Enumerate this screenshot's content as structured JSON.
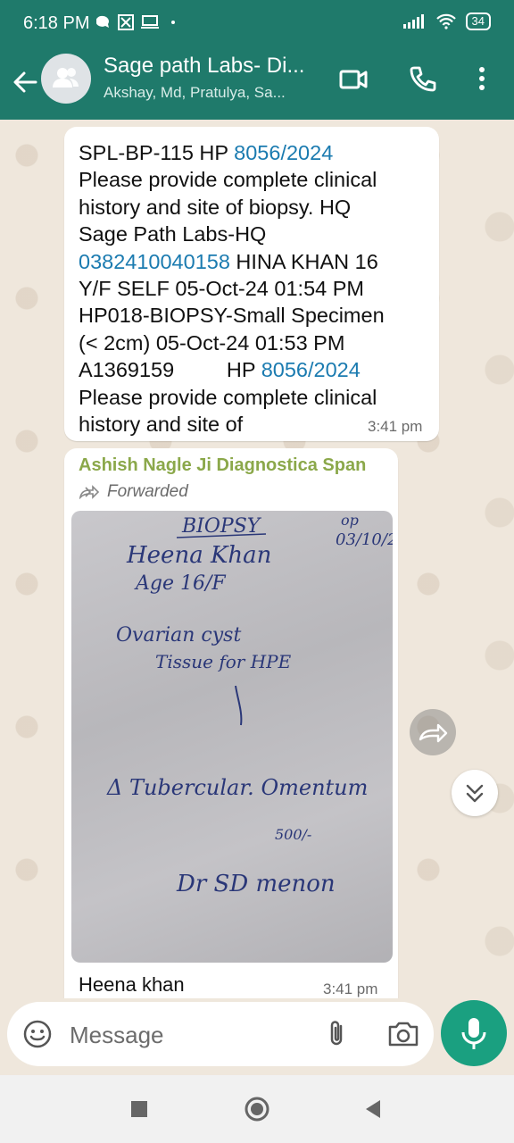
{
  "status_bar": {
    "time": "6:18 PM",
    "battery": "34"
  },
  "header": {
    "title": "Sage path Labs- Di...",
    "subtitle": "Akshay, Md, Pratulya, Sa..."
  },
  "messages": {
    "first": {
      "lines": [
        {
          "text": "SPL-BP-115 HP ",
          "link": "8056/2024"
        },
        {
          "text": "Please provide complete clinical"
        },
        {
          "text": "history and site of biopsy.  HQ"
        },
        {
          "text": "Sage Path Labs-HQ"
        },
        {
          "link": "0382410040158",
          "text": " HINA KHAN 16"
        },
        {
          "text": "Y/F SELF 05-Oct-24 01:54 PM"
        },
        {
          "text": "HP018-BIOPSY-Small Specimen"
        },
        {
          "text": "(< 2cm) 05-Oct-24 01:53 PM"
        },
        {
          "text": "A1369159         HP ",
          "link": "8056/2024"
        },
        {
          "text": "Please provide complete clinical"
        },
        {
          "text": "history and site of"
        }
      ],
      "time": "3:41 pm"
    },
    "second": {
      "sender": "Ashish Nagle Ji Diagnostica Span",
      "forwarded_label": "Forwarded",
      "photo_handwriting": [
        "BIOPSY",
        "op",
        "03/10/2",
        "Heena Khan",
        "Age 16/F",
        "Ovarian cyst",
        "Tissue for HPE",
        "Δ Tubercular. Omentum",
        "500/-",
        "Dr SD menon"
      ],
      "caption": "Heena khan",
      "time": "3:41 pm"
    }
  },
  "input": {
    "placeholder": "Message"
  },
  "colors": {
    "header": "#1f7a6b",
    "accent": "#1aa080",
    "link": "#1b7bb0",
    "sender": "#8ba84a"
  }
}
